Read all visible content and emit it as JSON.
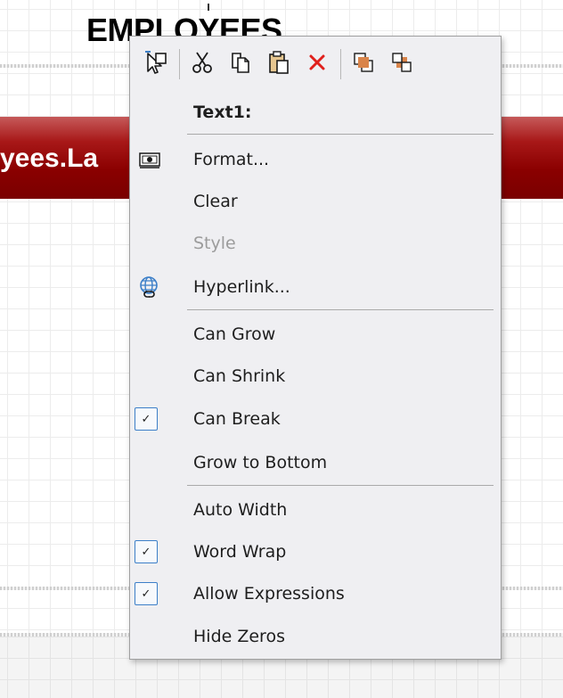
{
  "report": {
    "title": "EMPLOYEES",
    "field_text": "yees.La",
    "header_band_color": "#8a0000"
  },
  "context_menu": {
    "toolbar": [
      {
        "name": "select-icon",
        "tooltip": ""
      },
      {
        "name": "cut-icon"
      },
      {
        "name": "copy-icon"
      },
      {
        "name": "paste-icon"
      },
      {
        "name": "delete-icon",
        "color": "#e0201c"
      },
      {
        "name": "bring-to-front-icon"
      },
      {
        "name": "send-to-back-icon"
      }
    ],
    "section_title": "Text1:",
    "items": {
      "format": "Format...",
      "clear": "Clear",
      "style": "Style",
      "hyperlink": "Hyperlink...",
      "can_grow": "Can Grow",
      "can_shrink": "Can Shrink",
      "can_break": "Can Break",
      "grow_to_bottom": "Grow to Bottom",
      "auto_width": "Auto Width",
      "word_wrap": "Word Wrap",
      "allow_expressions": "Allow Expressions",
      "hide_zeros": "Hide Zeros"
    },
    "checked": {
      "can_grow": false,
      "can_shrink": false,
      "can_break": true,
      "grow_to_bottom": false,
      "auto_width": false,
      "word_wrap": true,
      "allow_expressions": true,
      "hide_zeros": false
    },
    "check_glyph": "✓",
    "accent_color": "#3c7fc8",
    "disabled_items": [
      "style"
    ]
  }
}
